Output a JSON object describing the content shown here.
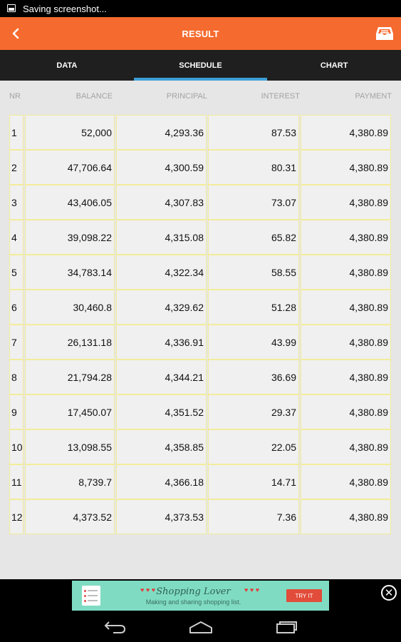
{
  "status_bar": {
    "text": "Saving screenshot...",
    "icon": "screenshot-icon"
  },
  "app_bar": {
    "title": "RESULT",
    "back_icon": "back-arrow-icon",
    "action_icon": "inbox-icon",
    "color": "#f56a2e"
  },
  "tabs": [
    {
      "label": "DATA",
      "active": false
    },
    {
      "label": "SCHEDULE",
      "active": true
    },
    {
      "label": "CHART",
      "active": false
    }
  ],
  "accent_color": "#3d9fd8",
  "table": {
    "headers": [
      "NR",
      "BALANCE",
      "PRINCIPAL",
      "INTEREST",
      "PAYMENT"
    ],
    "rows": [
      [
        "1",
        "52,000",
        "4,293.36",
        "87.53",
        "4,380.89"
      ],
      [
        "2",
        "47,706.64",
        "4,300.59",
        "80.31",
        "4,380.89"
      ],
      [
        "3",
        "43,406.05",
        "4,307.83",
        "73.07",
        "4,380.89"
      ],
      [
        "4",
        "39,098.22",
        "4,315.08",
        "65.82",
        "4,380.89"
      ],
      [
        "5",
        "34,783.14",
        "4,322.34",
        "58.55",
        "4,380.89"
      ],
      [
        "6",
        "30,460.8",
        "4,329.62",
        "51.28",
        "4,380.89"
      ],
      [
        "7",
        "26,131.18",
        "4,336.91",
        "43.99",
        "4,380.89"
      ],
      [
        "8",
        "21,794.28",
        "4,344.21",
        "36.69",
        "4,380.89"
      ],
      [
        "9",
        "17,450.07",
        "4,351.52",
        "29.37",
        "4,380.89"
      ],
      [
        "10",
        "13,098.55",
        "4,358.85",
        "22.05",
        "4,380.89"
      ],
      [
        "11",
        "8,739.7",
        "4,366.18",
        "14.71",
        "4,380.89"
      ],
      [
        "12",
        "4,373.52",
        "4,373.53",
        "7.36",
        "4,380.89"
      ]
    ]
  },
  "ad": {
    "title": "Shopping Lover",
    "subtitle": "Making and sharing shopping list.",
    "cta": "TRY IT",
    "close_icon": "close-circle-icon"
  },
  "nav_bar": {
    "back": "nav-back-icon",
    "home": "nav-home-icon",
    "recents": "nav-recents-icon"
  }
}
